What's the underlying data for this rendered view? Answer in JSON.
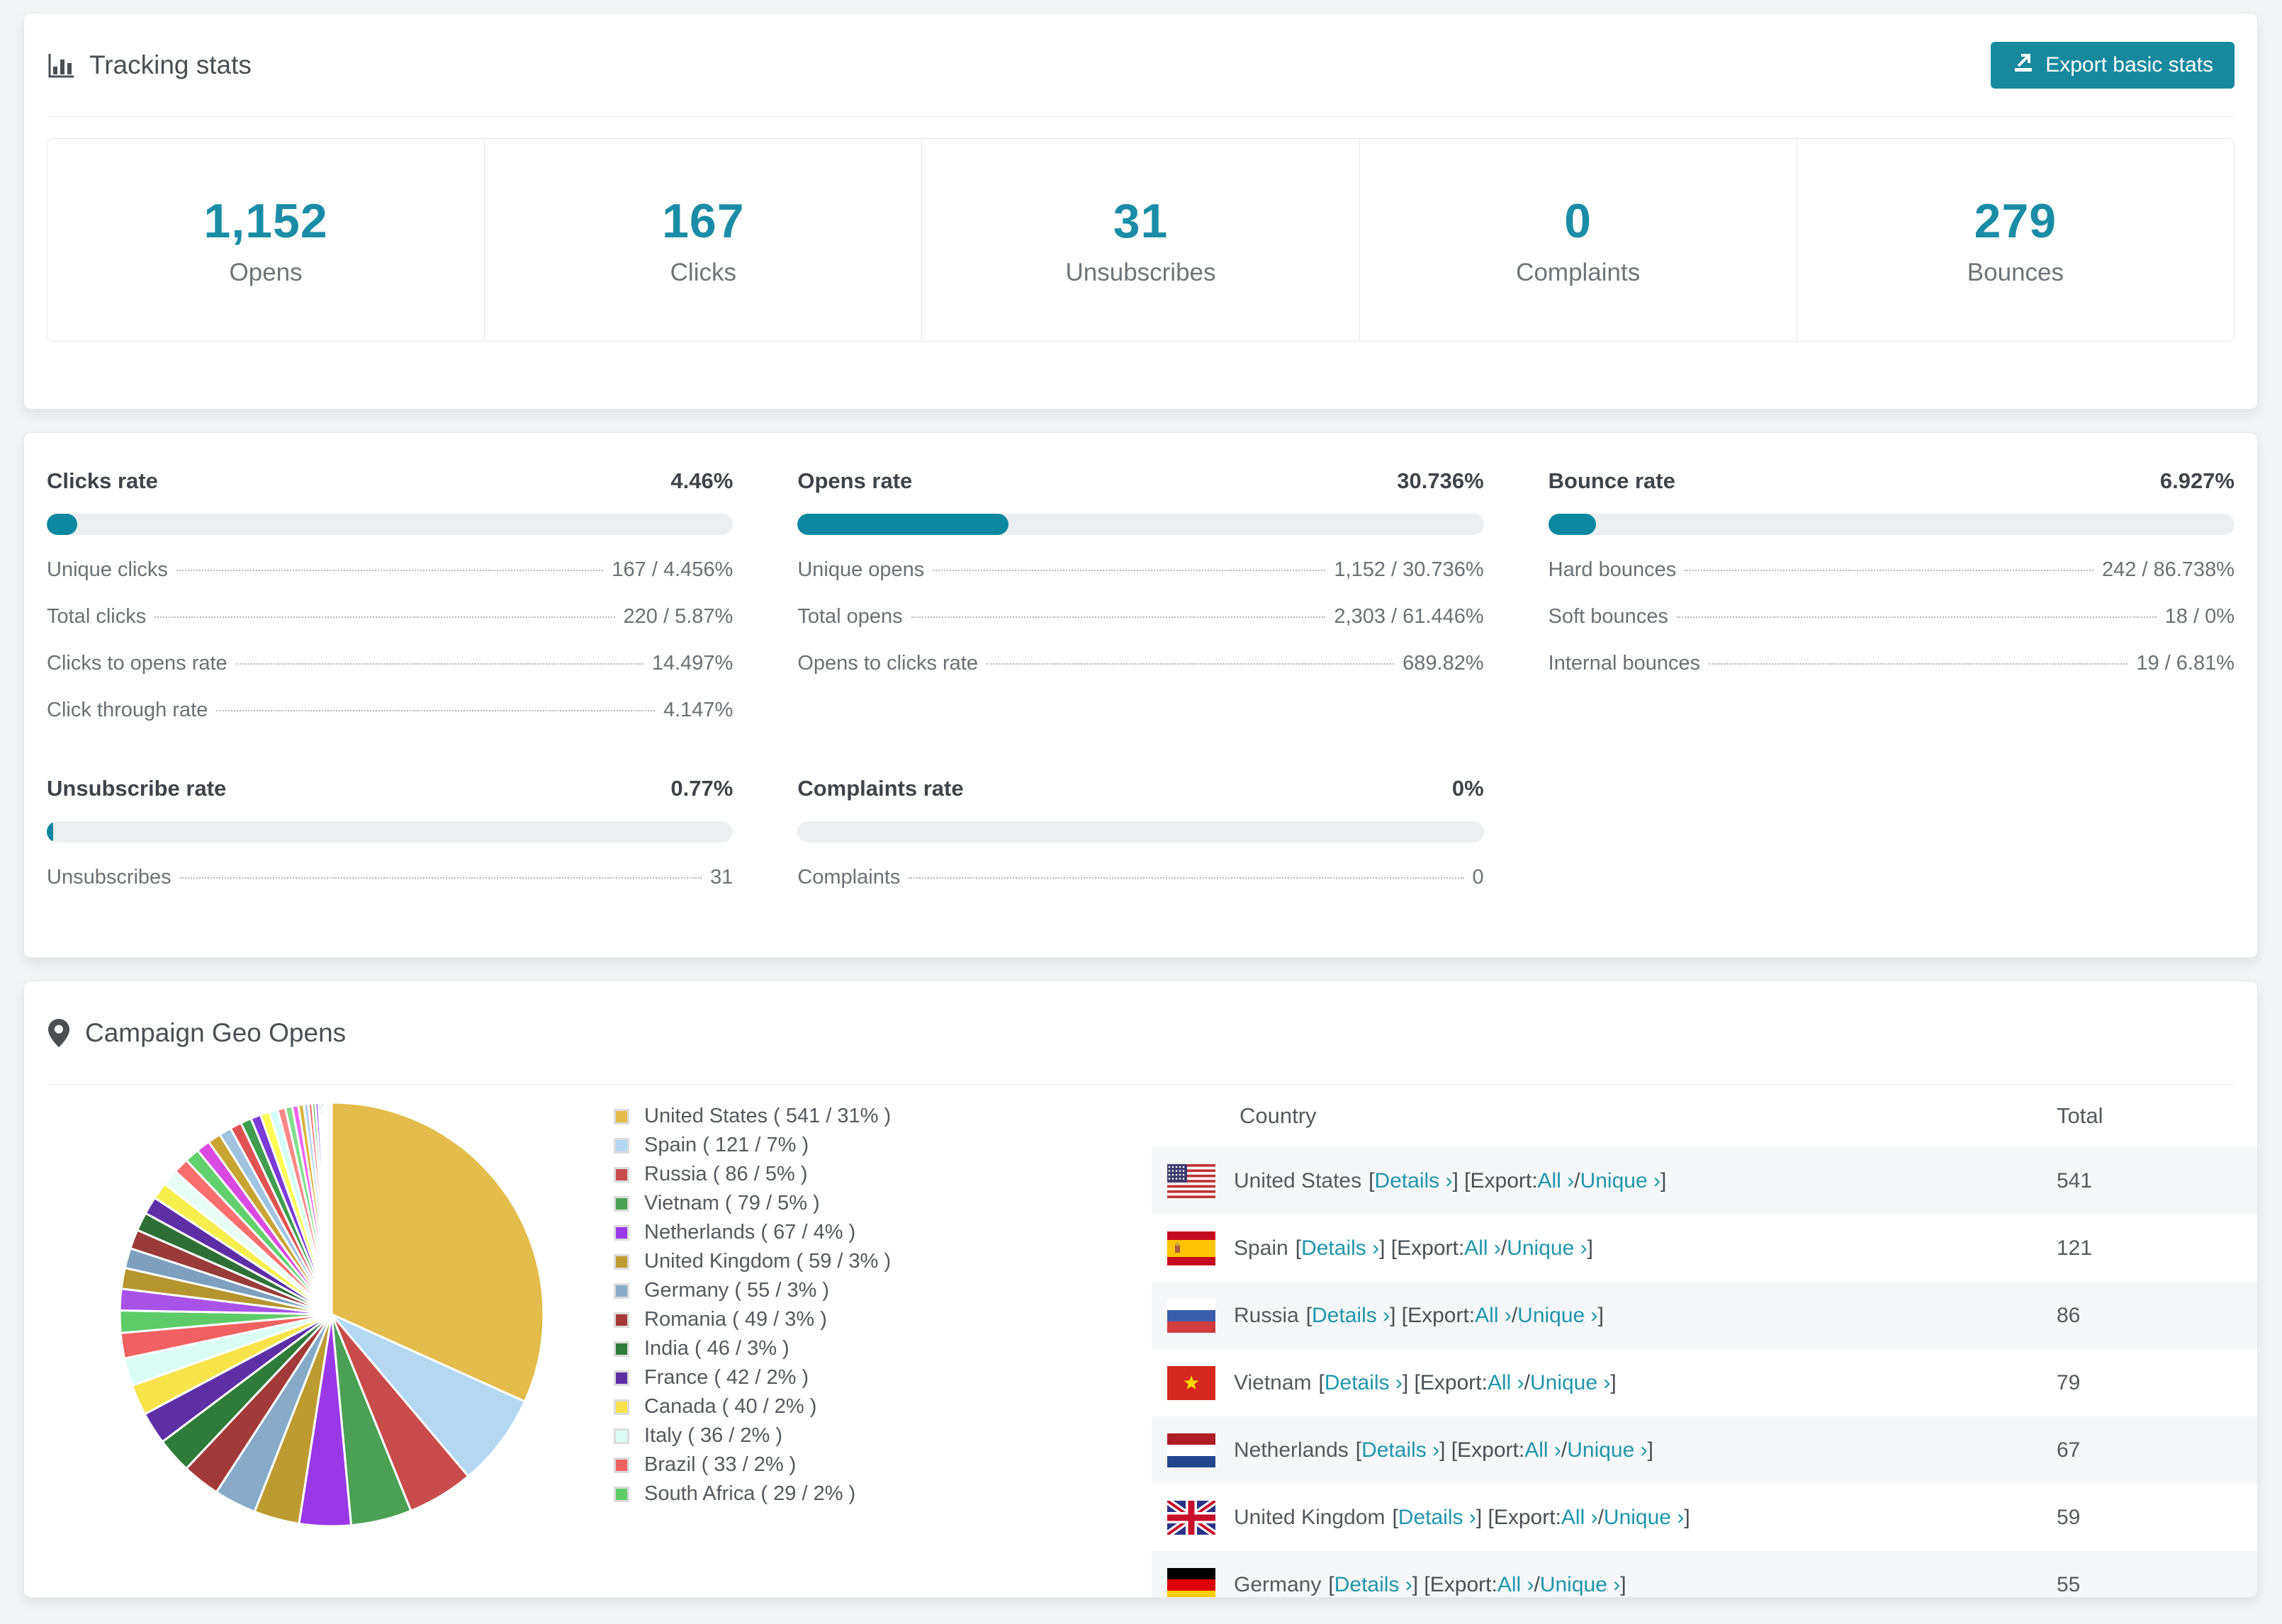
{
  "colors": {
    "accent_teal": "#17899f",
    "stat_number_teal": "#1b8ca6",
    "link_teal": "#2095ad",
    "progress_fill": "#0e87a1",
    "progress_track": "#eceff1",
    "page_background": "#f4f5f7",
    "row_stripe": "#f6f7f8"
  },
  "tracking": {
    "title": "Tracking stats",
    "export_button": "Export basic stats",
    "stats": [
      {
        "value": "1,152",
        "label": "Opens"
      },
      {
        "value": "167",
        "label": "Clicks"
      },
      {
        "value": "31",
        "label": "Unsubscribes"
      },
      {
        "value": "0",
        "label": "Complaints"
      },
      {
        "value": "279",
        "label": "Bounces"
      }
    ]
  },
  "rates": {
    "sections": [
      {
        "title": "Clicks rate",
        "value": "4.46%",
        "pct": 4.46,
        "rows": [
          {
            "label": "Unique clicks",
            "value": "167 / 4.456%"
          },
          {
            "label": "Total clicks",
            "value": "220 / 5.87%"
          },
          {
            "label": "Clicks to opens rate",
            "value": "14.497%"
          },
          {
            "label": "Click through rate",
            "value": "4.147%"
          }
        ]
      },
      {
        "title": "Opens rate",
        "value": "30.736%",
        "pct": 30.736,
        "rows": [
          {
            "label": "Unique opens",
            "value": "1,152 / 30.736%"
          },
          {
            "label": "Total opens",
            "value": "2,303 / 61.446%"
          },
          {
            "label": "Opens to clicks rate",
            "value": "689.82%"
          }
        ]
      },
      {
        "title": "Bounce rate",
        "value": "6.927%",
        "pct": 6.927,
        "rows": [
          {
            "label": "Hard bounces",
            "value": "242 / 86.738%"
          },
          {
            "label": "Soft bounces",
            "value": "18 / 0%"
          },
          {
            "label": "Internal bounces",
            "value": "19 / 6.81%"
          }
        ]
      },
      {
        "title": "Unsubscribe rate",
        "value": "0.77%",
        "pct": 0.77,
        "rows": [
          {
            "label": "Unsubscribes",
            "value": "31"
          }
        ]
      },
      {
        "title": "Complaints rate",
        "value": "0%",
        "pct": 0,
        "rows": [
          {
            "label": "Complaints",
            "value": "0"
          }
        ]
      }
    ]
  },
  "geo": {
    "title": "Campaign Geo Opens",
    "table": {
      "headers": [
        "Country",
        "Total"
      ],
      "link_labels": {
        "details": "Details ›",
        "export": "Export:",
        "all": "All ›",
        "unique": "Unique ›",
        "sep": "/"
      },
      "rows": [
        {
          "flag": "us",
          "country": "United States",
          "total": "541"
        },
        {
          "flag": "es",
          "country": "Spain",
          "total": "121"
        },
        {
          "flag": "ru",
          "country": "Russia",
          "total": "86"
        },
        {
          "flag": "vn",
          "country": "Vietnam",
          "total": "79"
        },
        {
          "flag": "nl",
          "country": "Netherlands",
          "total": "67"
        },
        {
          "flag": "gb",
          "country": "United Kingdom",
          "total": "59"
        },
        {
          "flag": "de",
          "country": "Germany",
          "total": "55"
        }
      ]
    }
  },
  "chart_data": {
    "type": "pie",
    "title": "Campaign Geo Opens",
    "legend_position": "right",
    "start_angle_deg": 0,
    "direction": "clockwise",
    "slices": [
      {
        "label": "United States",
        "value": 541,
        "pct": 31,
        "color": "#e3bc4b"
      },
      {
        "label": "Spain",
        "value": 121,
        "pct": 7,
        "color": "#b5d8f2"
      },
      {
        "label": "Russia",
        "value": 86,
        "pct": 5,
        "color": "#c94b4b"
      },
      {
        "label": "Vietnam",
        "value": 79,
        "pct": 5,
        "color": "#4ba153"
      },
      {
        "label": "Netherlands",
        "value": 67,
        "pct": 4,
        "color": "#9a38e8"
      },
      {
        "label": "United Kingdom",
        "value": 59,
        "pct": 3,
        "color": "#bd9b31"
      },
      {
        "label": "Germany",
        "value": 55,
        "pct": 3,
        "color": "#88aac9"
      },
      {
        "label": "Romania",
        "value": 49,
        "pct": 3,
        "color": "#a23a3a"
      },
      {
        "label": "India",
        "value": 46,
        "pct": 3,
        "color": "#2f7b3a"
      },
      {
        "label": "France",
        "value": 42,
        "pct": 2,
        "color": "#5c2fa5"
      },
      {
        "label": "Canada",
        "value": 40,
        "pct": 2,
        "color": "#f8e34b"
      },
      {
        "label": "Italy",
        "value": 36,
        "pct": 2,
        "color": "#dafdf5"
      },
      {
        "label": "Brazil",
        "value": 33,
        "pct": 2,
        "color": "#f16161"
      },
      {
        "label": "South Africa",
        "value": 29,
        "pct": 2,
        "color": "#5ecb68"
      }
    ],
    "other_slices": {
      "note": "unlabeled smaller countries, values estimated from slice widths",
      "values": [
        28,
        27,
        26,
        25,
        24,
        23,
        22,
        21,
        20,
        19,
        18,
        17,
        16,
        15,
        14,
        13,
        12,
        11,
        10,
        9,
        8,
        7,
        6,
        5,
        4,
        4,
        3,
        3,
        2,
        2,
        2,
        1,
        1,
        1,
        1,
        1
      ],
      "colors": [
        "#a852e8",
        "#b5952e",
        "#7e9fbe",
        "#993b3b",
        "#2e6f37",
        "#5c2fa5",
        "#f5ef4e",
        "#e8fdf6",
        "#fa6e6e",
        "#62d06c",
        "#d94ae0",
        "#c8a433",
        "#9fc3e0",
        "#e05252",
        "#3f9e4d",
        "#7a3bd6",
        "#fdfd54",
        "#d2fff8",
        "#ff8888",
        "#7fe08a",
        "#ee66ee",
        "#d7b43a",
        "#b3d4ee",
        "#f07878",
        "#57b25f",
        "#8e4ae8",
        "#1b2a6b",
        "#0c4f22",
        "#7a1f1f",
        "#2b7f8a",
        "#c9a0ff",
        "#ffd37a",
        "#a4d9ff",
        "#ffb3b3",
        "#baf2c0",
        "#e9c6ff"
      ]
    }
  }
}
